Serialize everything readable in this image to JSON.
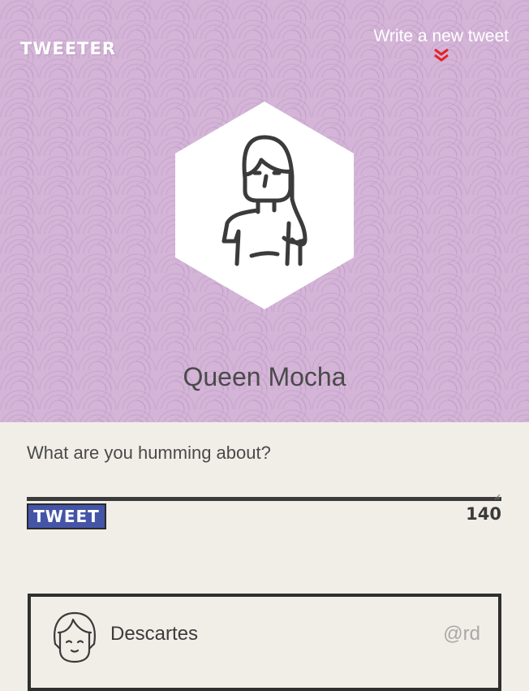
{
  "header": {
    "logo": "TWEETER",
    "compose_label": "Write a new tweet",
    "compose_icon": "double-chevron-down-icon",
    "accent_color": "#d4b5d8",
    "chevron_color": "#e3232a"
  },
  "profile": {
    "avatar": "woman-avatar-icon",
    "name": "Queen Mocha"
  },
  "composer": {
    "prompt": "What are you humming about?",
    "input_value": "",
    "tweet_button": "TWEET",
    "button_color": "#4455a8",
    "char_count": "140"
  },
  "tweets": [
    {
      "avatar": "girl-avatar-icon",
      "name": "Descartes",
      "handle": "@rd"
    }
  ]
}
